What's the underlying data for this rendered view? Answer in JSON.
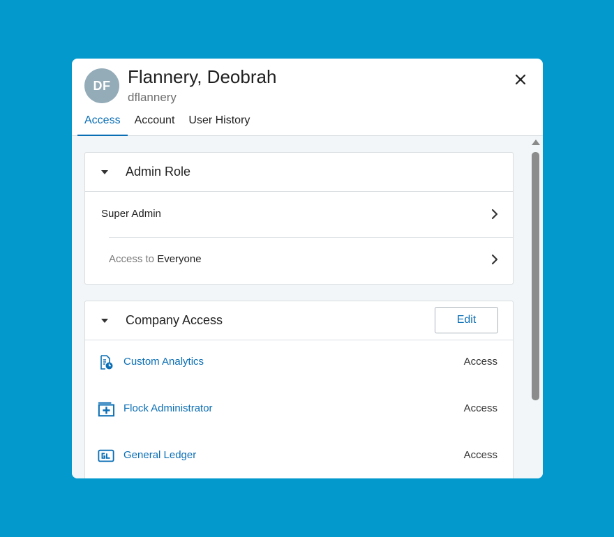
{
  "user": {
    "initials": "DF",
    "name": "Flannery, Deobrah",
    "username": "dflannery"
  },
  "tabs": [
    {
      "label": "Access",
      "active": true
    },
    {
      "label": "Account",
      "active": false
    },
    {
      "label": "User History",
      "active": false
    }
  ],
  "admin_role": {
    "title": "Admin Role",
    "role": "Super Admin",
    "access_prefix": "Access to",
    "access_scope": "Everyone"
  },
  "company_access": {
    "title": "Company Access",
    "edit_label": "Edit",
    "apps": [
      {
        "name": "Custom Analytics",
        "icon": "analytics-report-icon",
        "access": "Access"
      },
      {
        "name": "Flock Administrator",
        "icon": "admin-folder-plus-icon",
        "access": "Access"
      },
      {
        "name": "General Ledger",
        "icon": "gl-icon",
        "access": "Access"
      }
    ]
  },
  "colors": {
    "page_background": "#0399cc",
    "accent": "#0a6eb4",
    "avatar": "#94abb8"
  }
}
